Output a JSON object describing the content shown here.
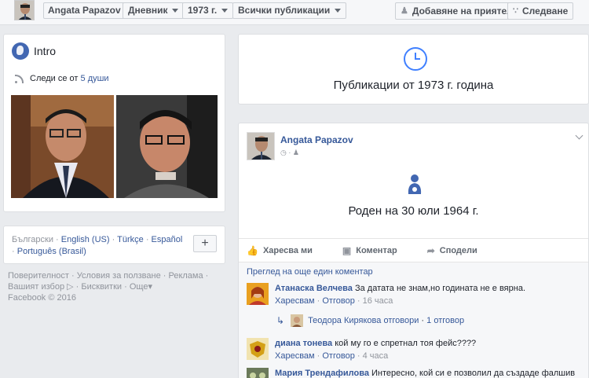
{
  "topbar": {
    "profile_name": "Angata Papazov",
    "diary": "Дневник",
    "year": "1973 г.",
    "filter": "Всички публикации",
    "add_friend": "Добавяне на приятел",
    "follow": "Следване"
  },
  "intro": {
    "title": "Intro",
    "followed_prefix": "Следи се от",
    "followed_count": "5 души"
  },
  "languages": {
    "current": "Български",
    "items": [
      "English (US)",
      "Türkçe",
      "Español",
      "Português (Brasil)"
    ],
    "plus": "+"
  },
  "footer": {
    "privacy": "Поверителност",
    "terms": "Условия за ползване",
    "ads": "Реклама",
    "ad_choices": "Вашият избор",
    "cookies": "Бисквитки",
    "more": "Още",
    "copyright": "Facebook © 2016"
  },
  "year_card": {
    "title": "Публикации от 1973 г. година"
  },
  "post": {
    "author": "Angata Papazov",
    "event": "Роден на 30 юли 1964 г.",
    "like": "Харесва ми",
    "comment": "Коментар",
    "share": "Сподели"
  },
  "comments": {
    "more_label": "Преглед на още един коментар",
    "like_label": "Харесвам",
    "reply_label": "Отговор",
    "items": [
      {
        "name": "Атанаска Велчева",
        "text": "За датата не знам,но годината не е вярна.",
        "time": "16 часа"
      },
      {
        "name": "диана тонева",
        "text": "кой му го е спретнал тоя фейс????",
        "time": "4 часа"
      },
      {
        "name": "Мария Трендафилова",
        "text": "Интересно, кой си е позволил да създаде фалшив"
      }
    ],
    "reply": {
      "name": "Теодора Кирякова",
      "action": "отговори",
      "count": "1 отговор"
    }
  }
}
